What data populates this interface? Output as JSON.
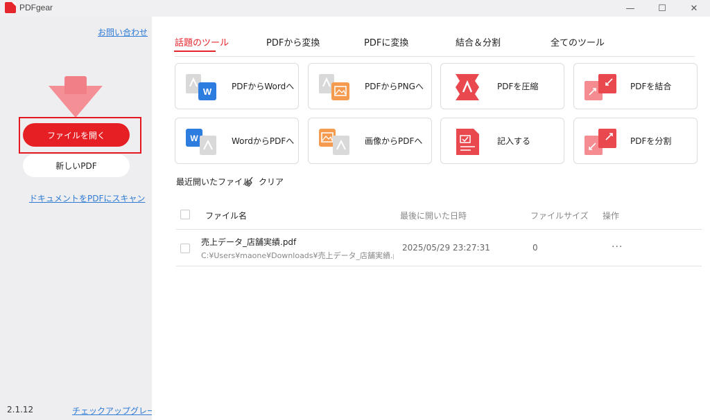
{
  "window": {
    "title": "PDFgear",
    "minimize": "—",
    "maximize": "☐",
    "close": "✕"
  },
  "sidebar": {
    "contact_link": "お問い合わせ",
    "open_file_button": "ファイルを開く",
    "new_pdf_button": "新しいPDF",
    "scan_link": "ドキュメントをPDFにスキャン",
    "version": "2.1.12",
    "check_upgrade_link": "チェックアップグレード"
  },
  "tabs": [
    {
      "label": "話題のツール",
      "active": true
    },
    {
      "label": "PDFから変換",
      "active": false
    },
    {
      "label": "PDFに変換",
      "active": false
    },
    {
      "label": "結合＆分割",
      "active": false
    },
    {
      "label": "全てのツール",
      "active": false
    }
  ],
  "tools": [
    {
      "label": "PDFからWordへ",
      "icon": "pdf-to-word-icon"
    },
    {
      "label": "PDFからPNGへ",
      "icon": "pdf-to-png-icon"
    },
    {
      "label": "PDFを圧縮",
      "icon": "compress-pdf-icon"
    },
    {
      "label": "PDFを結合",
      "icon": "merge-pdf-icon"
    },
    {
      "label": "WordからPDFへ",
      "icon": "word-to-pdf-icon"
    },
    {
      "label": "画像からPDFへ",
      "icon": "image-to-pdf-icon"
    },
    {
      "label": "記入する",
      "icon": "fill-form-icon"
    },
    {
      "label": "PDFを分割",
      "icon": "split-pdf-icon"
    }
  ],
  "recent": {
    "title": "最近開いたファイル",
    "clear_label": "クリア",
    "columns": {
      "name": "ファイル名",
      "last_opened": "最後に開いた日時",
      "size": "ファイルサイズ",
      "actions": "操作"
    },
    "rows": [
      {
        "name": "売上データ_店舗実績.pdf",
        "path": "C:¥Users¥maone¥Downloads¥売上データ_店舗実績.pdf",
        "last_opened": "2025/05/29 23:27:31",
        "size": "0",
        "actions": "···"
      }
    ]
  },
  "colors": {
    "accent": "#e61f25",
    "link": "#2e7bd6",
    "sidebar_bg": "#eeeef0"
  }
}
